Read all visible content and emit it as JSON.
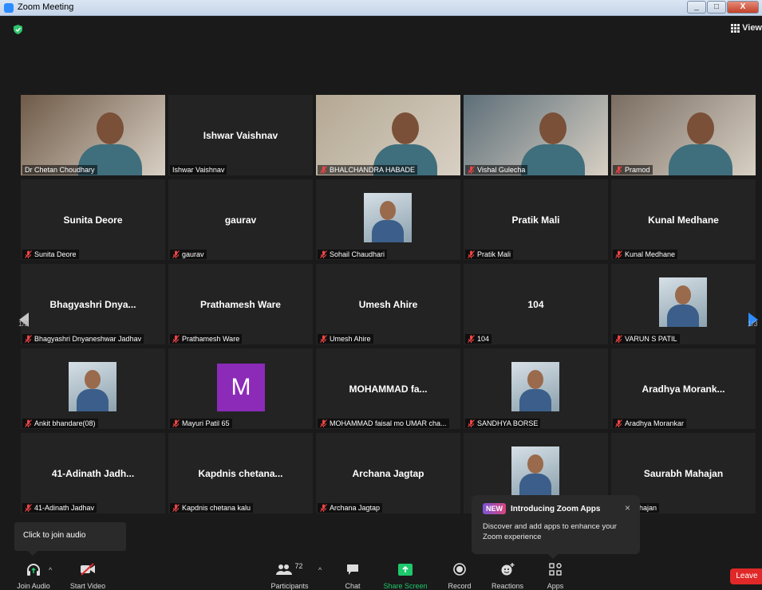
{
  "window": {
    "title": "Zoom Meeting",
    "buttons": [
      "_",
      "□",
      "X"
    ]
  },
  "header": {
    "view_label": "View"
  },
  "pagination": {
    "left": "1/3",
    "right": "1/3"
  },
  "tiles": [
    {
      "big": "",
      "label": "Dr Chetan Choudhary",
      "muted": false,
      "active": true,
      "photo": "video"
    },
    {
      "big": "Ishwar Vaishnav",
      "label": "Ishwar Vaishnav",
      "muted": false
    },
    {
      "big": "",
      "label": "BHALCHANDRA HABADE",
      "muted": true,
      "photo": "video"
    },
    {
      "big": "",
      "label": "Vishal Gulecha",
      "muted": true,
      "photo": "video"
    },
    {
      "big": "",
      "label": "Pramod",
      "muted": true,
      "photo": "video"
    },
    {
      "big": "Sunita Deore",
      "label": "Sunita Deore",
      "muted": true
    },
    {
      "big": "gaurav",
      "label": "gaurav",
      "muted": true
    },
    {
      "big": "",
      "label": "Sohail Chaudhari",
      "muted": true,
      "photo": "avatar"
    },
    {
      "big": "Pratik Mali",
      "label": "Pratik Mali",
      "muted": true
    },
    {
      "big": "Kunal Medhane",
      "label": "Kunal Medhane",
      "muted": true
    },
    {
      "big": "Bhagyashri  Dnya...",
      "label": "Bhagyashri Dnyaneshwar Jadhav",
      "muted": true
    },
    {
      "big": "Prathamesh Ware",
      "label": "Prathamesh Ware",
      "muted": true
    },
    {
      "big": "Umesh Ahire",
      "label": "Umesh Ahire",
      "muted": true
    },
    {
      "big": "104",
      "label": "104",
      "muted": true
    },
    {
      "big": "",
      "label": "VARUN S PATIL",
      "muted": true,
      "photo": "avatar"
    },
    {
      "big": "",
      "label": "Ankit bhandare(08)",
      "muted": true,
      "photo": "avatar"
    },
    {
      "big": "",
      "label": "Mayuri Patil 65",
      "muted": true,
      "letter": "M"
    },
    {
      "big": "MOHAMMAD  fa...",
      "label": "MOHAMMAD faisal mo UMAR cha...",
      "muted": true
    },
    {
      "big": "",
      "label": "SANDHYA BORSE",
      "muted": true,
      "photo": "avatar"
    },
    {
      "big": "Aradhya  Morank...",
      "label": "Aradhya Morankar",
      "muted": true
    },
    {
      "big": "41-Adinath  Jadh...",
      "label": "41-Adinath Jadhav",
      "muted": true
    },
    {
      "big": "Kapdnis  chetana...",
      "label": "Kapdnis chetana kalu",
      "muted": true
    },
    {
      "big": "Archana Jagtap",
      "label": "Archana Jagtap",
      "muted": true
    },
    {
      "big": "",
      "label": "",
      "muted": true,
      "photo": "avatar"
    },
    {
      "big": "Saurabh Mahajan",
      "label": "abh Mahajan",
      "muted": false
    }
  ],
  "tooltip": {
    "join_audio": "Click to join audio"
  },
  "apps_popup": {
    "badge": "NEW",
    "title": "Introducing Zoom Apps",
    "close": "×",
    "body": "Discover and add apps to enhance your Zoom experience"
  },
  "toolbar": {
    "join_audio": "Join Audio",
    "start_video": "Start Video",
    "participants": "Participants",
    "participants_count": "72",
    "chat": "Chat",
    "share_screen": "Share Screen",
    "record": "Record",
    "reactions": "Reactions",
    "apps": "Apps",
    "leave": "Leave"
  },
  "colors": {
    "active_speaker": "#c8e34b",
    "share": "#1ec96b",
    "leave": "#e02828",
    "accent": "#2d8cff"
  }
}
